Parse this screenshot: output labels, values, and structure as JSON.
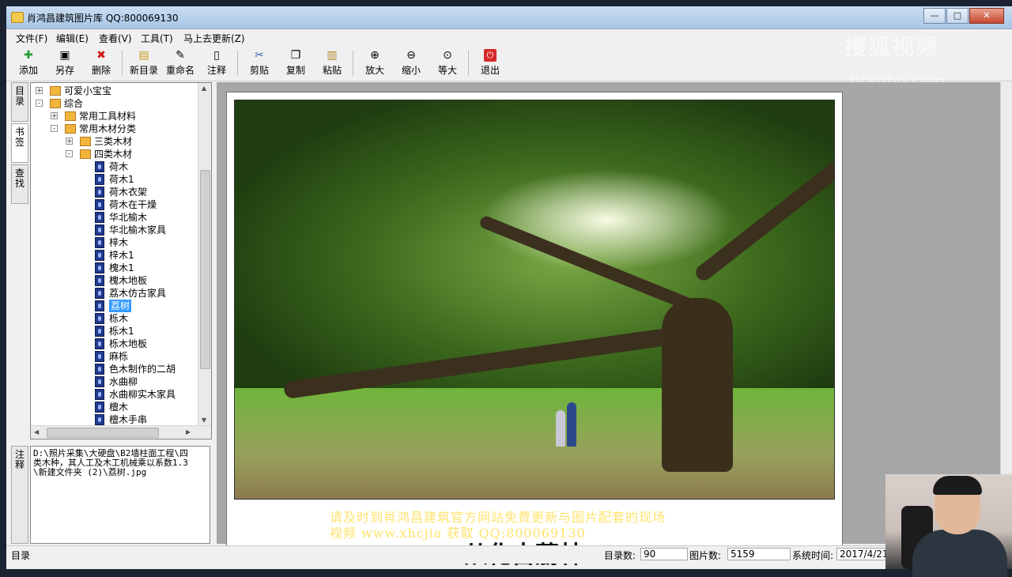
{
  "window": {
    "title": "肖鸿昌建筑图片库 QQ:800069130"
  },
  "menu": [
    "文件(F)",
    "编辑(E)",
    "查看(V)",
    "工具(T)",
    "马上去更新(Z)"
  ],
  "toolbar": [
    {
      "label": "添加",
      "icon": "add-icon"
    },
    {
      "label": "另存",
      "icon": "save-icon"
    },
    {
      "label": "删除",
      "icon": "delete-icon"
    },
    {
      "label": "新目录",
      "icon": "new-folder-icon"
    },
    {
      "label": "重命名",
      "icon": "rename-icon"
    },
    {
      "label": "注释",
      "icon": "note-icon"
    },
    {
      "label": "剪贴",
      "icon": "cut-icon"
    },
    {
      "label": "复制",
      "icon": "copy-icon"
    },
    {
      "label": "粘贴",
      "icon": "paste-icon"
    },
    {
      "label": "放大",
      "icon": "zoom-in-icon"
    },
    {
      "label": "缩小",
      "icon": "zoom-out-icon"
    },
    {
      "label": "等大",
      "icon": "actual-size-icon"
    },
    {
      "label": "退出",
      "icon": "exit-icon"
    }
  ],
  "side_tabs": [
    "目录",
    "书签",
    "查找"
  ],
  "tree": [
    {
      "label": "可爱小宝宝",
      "type": "folder",
      "level": 0,
      "exp": "+"
    },
    {
      "label": "综合",
      "type": "folder",
      "level": 0,
      "exp": "-"
    },
    {
      "label": "常用工具材料",
      "type": "folder",
      "level": 1,
      "exp": "+"
    },
    {
      "label": "常用木材分类",
      "type": "folder",
      "level": 1,
      "exp": "-"
    },
    {
      "label": "三类木材",
      "type": "folder",
      "level": 2,
      "exp": "+"
    },
    {
      "label": "四类木材",
      "type": "folder",
      "level": 2,
      "exp": "-"
    },
    {
      "label": "荷木",
      "type": "file",
      "level": 3
    },
    {
      "label": "荷木1",
      "type": "file",
      "level": 3
    },
    {
      "label": "荷木衣架",
      "type": "file",
      "level": 3
    },
    {
      "label": "荷木在干燥",
      "type": "file",
      "level": 3
    },
    {
      "label": "华北榆木",
      "type": "file",
      "level": 3
    },
    {
      "label": "华北榆木家具",
      "type": "file",
      "level": 3
    },
    {
      "label": "梓木",
      "type": "file",
      "level": 3
    },
    {
      "label": "梓木1",
      "type": "file",
      "level": 3
    },
    {
      "label": "槐木1",
      "type": "file",
      "level": 3
    },
    {
      "label": "槐木地板",
      "type": "file",
      "level": 3
    },
    {
      "label": "荔木仿古家具",
      "type": "file",
      "level": 3
    },
    {
      "label": "荔树",
      "type": "file",
      "level": 3,
      "selected": true
    },
    {
      "label": "栎木",
      "type": "file",
      "level": 3
    },
    {
      "label": "栎木1",
      "type": "file",
      "level": 3
    },
    {
      "label": "栎木地板",
      "type": "file",
      "level": 3
    },
    {
      "label": "麻栎",
      "type": "file",
      "level": 3
    },
    {
      "label": "色木制作的二胡",
      "type": "file",
      "level": 3
    },
    {
      "label": "水曲柳",
      "type": "file",
      "level": 3
    },
    {
      "label": "水曲柳实木家具",
      "type": "file",
      "level": 3
    },
    {
      "label": "檀木",
      "type": "file",
      "level": 3
    },
    {
      "label": "檀木手串",
      "type": "file",
      "level": 3
    }
  ],
  "notes": {
    "tab": "注释",
    "text": "D:\\照片采集\\大硬盘\\B2墙柱面工程\\四类木种，其人工及木工机械乘以系数1.3\\新建文件夹 (2)\\荔树.jpg"
  },
  "viewer": {
    "watermark_line1": "请及时到肖鸿昌建筑官方网站免费更新与图片配套的现场",
    "watermark_line2": "视频 www.xhcjia        获取 QQ:800069130",
    "big_title": "从化古荔林"
  },
  "brand": {
    "line1": "搜狐视频",
    "line2": "tv.sohu.com"
  },
  "status": {
    "left": "目录",
    "dir_count_label": "目录数:",
    "dir_count": "90",
    "pic_count_label": "图片数:",
    "pic_count": "5159",
    "time_label": "系统时间:",
    "time": "2017/4/21"
  }
}
